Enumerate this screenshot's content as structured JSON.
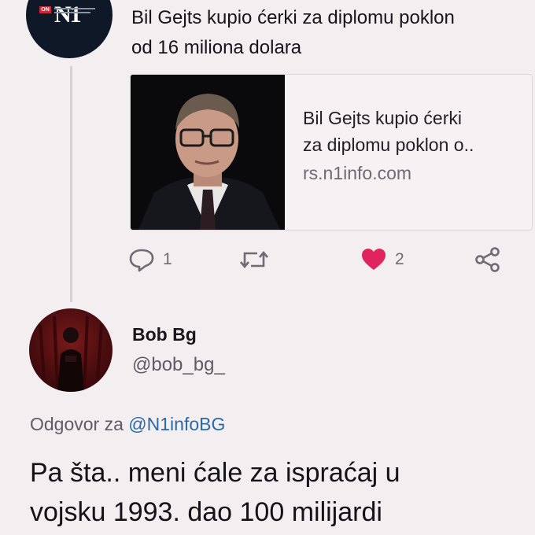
{
  "quoted_tweet": {
    "avatar": {
      "logo_text": "N1",
      "badge_text": "ON"
    },
    "text": "Bil Gejts kupio ćerki za diplomu poklon\nod 16 miliona dolara",
    "link_card": {
      "title": "Bil Gejts kupio ćerki\nza diplomu poklon o..",
      "domain": "rs.n1info.com"
    },
    "actions": {
      "reply": {
        "icon": "reply-bubble-icon",
        "count": "1"
      },
      "retweet": {
        "icon": "retweet-icon",
        "count": ""
      },
      "like": {
        "icon": "heart-icon",
        "count": "2",
        "color": "#e0245e"
      },
      "share": {
        "icon": "share-icon"
      }
    }
  },
  "reply_tweet": {
    "name": "Bob Bg",
    "handle": "@bob_bg_",
    "reply_prefix": "Odgovor za",
    "reply_mention": "@N1infoBG",
    "text": "Pa šta.. meni ćale za ispraćaj u\nvojsku 1993. dao 100 milijardi"
  },
  "colors": {
    "background": "#f3eef0",
    "mention": "#2a6aa8",
    "like": "#e0245e",
    "muted": "#6f6b72"
  }
}
